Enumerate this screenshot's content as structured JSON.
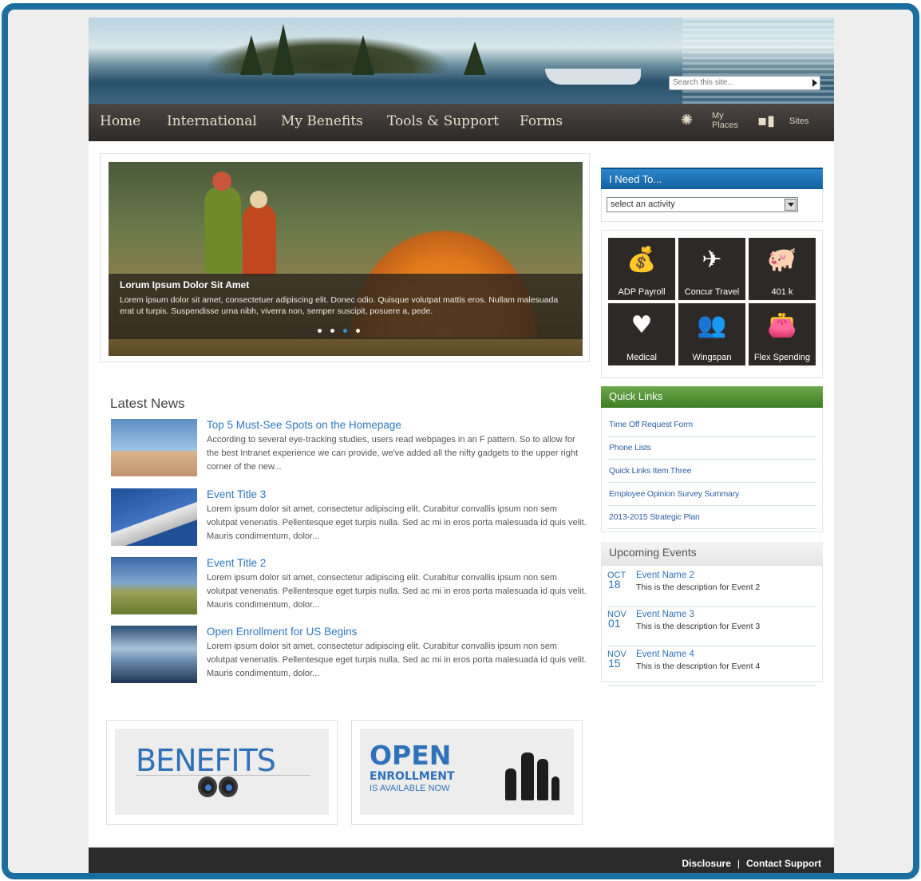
{
  "header": {
    "search_placeholder": "Search this site...",
    "nav": [
      "Home",
      "International",
      "My Benefits",
      "Tools & Support",
      "Forms"
    ],
    "my_places_line1": "My",
    "my_places_line2": "Places",
    "sites_label": "Sites"
  },
  "slider": {
    "title": "Lorum Ipsum Dolor Sit Amet",
    "text": "Lorem ipsum dolor sit amet, consectetuer adipiscing elit. Donec odio. Quisque volutpat mattis eros. Nullam malesuada erat ut turpis. Suspendisse urna nibh, viverra non, semper suscipit, posuere a, pede.",
    "dot_count": 4,
    "active_dot": 3
  },
  "news": {
    "title": "Latest News",
    "items": [
      {
        "headline": "Top 5 Must-See Spots on the Homepage",
        "body": "According to several eye-tracking studies, users read webpages in an F pattern. So to allow for the best Intranet experience we can provide, we've added all the nifty gadgets to the upper right corner of the new..."
      },
      {
        "headline": "Event Title 3",
        "body": "Lorem ipsum dolor sit amet, consectetur adipiscing elit. Curabitur convallis ipsum non sem volutpat venenatis. Pellentesque eget turpis nulla. Sed ac mi in eros porta malesuada id quis velit. Mauris condimentum, dolor..."
      },
      {
        "headline": "Event Title 2",
        "body": "Lorem ipsum dolor sit amet, consectetur adipiscing elit. Curabitur convallis ipsum non sem volutpat venenatis. Pellentesque eget turpis nulla. Sed ac mi in eros porta malesuada id quis velit. Mauris condimentum, dolor..."
      },
      {
        "headline": "Open Enrollment for US Begins",
        "body": "Lorem ipsum dolor sit amet, consectetur adipiscing elit. Curabitur convallis ipsum non sem volutpat venenatis. Pellentesque eget turpis nulla. Sed ac mi in eros porta malesuada id quis velit. Mauris condimentum, dolor..."
      }
    ]
  },
  "promos": {
    "benefits": "BENEFITS",
    "open": "OPEN",
    "enrollment": "ENROLLMENT",
    "available": "IS AVAILABLE NOW"
  },
  "ineed": {
    "title": "I Need To...",
    "select_value": "select an activity"
  },
  "tiles": [
    {
      "label": "ADP Payroll",
      "icon": "money-bag-icon"
    },
    {
      "label": "Concur Travel",
      "icon": "airplane-icon"
    },
    {
      "label": "401 k",
      "icon": "piggy-bank-icon"
    },
    {
      "label": "Medical",
      "icon": "heart-pulse-icon"
    },
    {
      "label": "Wingspan",
      "icon": "people-icon"
    },
    {
      "label": "Flex Spending",
      "icon": "wallet-icon"
    }
  ],
  "quick_links": {
    "title": "Quick Links",
    "items": [
      "Time Off Request Form",
      "Phone Lists",
      "Quick Links Item Three",
      "Employee Opinion Survey Summary",
      "2013-2015 Strategic Plan"
    ]
  },
  "events": {
    "title": "Upcoming Events",
    "items": [
      {
        "month": "OCT",
        "day": "18",
        "name": "Event Name 2",
        "desc": "This is the description for Event 2"
      },
      {
        "month": "NOV",
        "day": "01",
        "name": "Event Name 3",
        "desc": "This is the description for Event 3"
      },
      {
        "month": "NOV",
        "day": "15",
        "name": "Event Name 4",
        "desc": "This is the description for Event 4"
      }
    ]
  },
  "footer": {
    "disclosure": "Disclosure",
    "separator": "|",
    "contact": "Contact Support"
  },
  "colors": {
    "frame": "#1c6e9f",
    "nav_bg": "#2e2a27",
    "link_blue": "#2f78bd",
    "ineed_blue": "#14609e",
    "quick_green": "#3e7d24",
    "tile_dark": "#2d2926"
  }
}
